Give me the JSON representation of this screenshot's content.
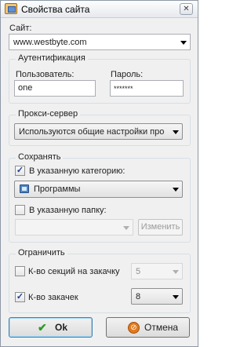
{
  "window": {
    "title": "Свойства сайта",
    "close_glyph": "✕"
  },
  "site": {
    "label": "Сайт:",
    "value": "www.westbyte.com"
  },
  "auth": {
    "title": "Аутентификация",
    "user_label": "Пользователь:",
    "user_value": "one",
    "password_label": "Пароль:",
    "password_value": "*******"
  },
  "proxy": {
    "title": "Прокси-сервер",
    "value": "Используются общие настройки про"
  },
  "save": {
    "title": "Сохранять",
    "to_category_label": "В указанную категорию:",
    "to_category_checked": true,
    "category_value": "Программы",
    "to_folder_label": "В указанную папку:",
    "to_folder_checked": false,
    "folder_value": "",
    "change_label": "Изменить"
  },
  "limit": {
    "title": "Ограничить",
    "sections_label": "К-во секций на закачку",
    "sections_checked": false,
    "sections_value": "5",
    "downloads_label": "К-во закачек",
    "downloads_checked": true,
    "downloads_value": "8"
  },
  "buttons": {
    "ok_label": "Ok",
    "cancel_label": "Отмена"
  },
  "icons": {
    "checkmark": "✓",
    "ok": "✔",
    "cancel": "⊘"
  },
  "colors": {
    "ok_icon": "#2f9a2a",
    "cancel_icon": "#e07a1f",
    "checkbox_mark": "#1c3f94"
  }
}
